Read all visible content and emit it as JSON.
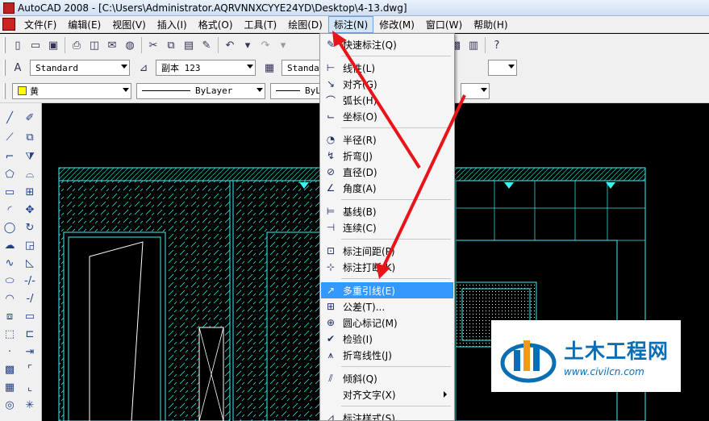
{
  "window": {
    "title": "AutoCAD 2008 - [C:\\Users\\Administrator.AQRVNNXCYYE24YD\\Desktop\\4-13.dwg]"
  },
  "menubar": [
    {
      "label": "文件(F)"
    },
    {
      "label": "编辑(E)"
    },
    {
      "label": "视图(V)"
    },
    {
      "label": "插入(I)"
    },
    {
      "label": "格式(O)"
    },
    {
      "label": "工具(T)"
    },
    {
      "label": "绘图(D)"
    },
    {
      "label": "标注(N)",
      "active": true
    },
    {
      "label": "修改(M)"
    },
    {
      "label": "窗口(W)"
    },
    {
      "label": "帮助(H)"
    }
  ],
  "styles_toolbar": {
    "text_style": "Standard",
    "dim_style": "副本 123",
    "table_style": "Standard"
  },
  "properties_toolbar": {
    "color": "黄",
    "linetype": "ByLayer",
    "lineweight": "ByL"
  },
  "dimension_menu": {
    "items": [
      {
        "label": "快速标注(Q)",
        "icon": "quick-dim-icon"
      },
      {
        "sep": true
      },
      {
        "label": "线性(L)",
        "icon": "linear-icon"
      },
      {
        "label": "对齐(G)",
        "icon": "aligned-icon"
      },
      {
        "label": "弧长(H)",
        "icon": "arc-length-icon"
      },
      {
        "label": "坐标(O)",
        "icon": "ordinate-icon"
      },
      {
        "sep": true
      },
      {
        "label": "半径(R)",
        "icon": "radius-icon"
      },
      {
        "label": "折弯(J)",
        "icon": "jogged-icon"
      },
      {
        "label": "直径(D)",
        "icon": "diameter-icon"
      },
      {
        "label": "角度(A)",
        "icon": "angular-icon"
      },
      {
        "sep": true
      },
      {
        "label": "基线(B)",
        "icon": "baseline-icon"
      },
      {
        "label": "连续(C)",
        "icon": "continue-icon"
      },
      {
        "sep": true
      },
      {
        "label": "标注间距(P)",
        "icon": "dim-space-icon"
      },
      {
        "label": "标注打断(K)",
        "icon": "dim-break-icon"
      },
      {
        "sep": true
      },
      {
        "label": "多重引线(E)",
        "icon": "multileader-icon",
        "highlighted": true
      },
      {
        "label": "公差(T)...",
        "icon": "tolerance-icon"
      },
      {
        "label": "圆心标记(M)",
        "icon": "center-mark-icon"
      },
      {
        "label": "检验(I)",
        "icon": "inspection-icon"
      },
      {
        "label": "折弯线性(J)",
        "icon": "jogged-linear-icon"
      },
      {
        "sep": true
      },
      {
        "label": "倾斜(Q)",
        "icon": "oblique-icon"
      },
      {
        "label": "对齐文字(X)",
        "icon": "",
        "submenu": true
      },
      {
        "sep": true
      },
      {
        "label": "标注样式(S)...",
        "icon": "dim-style-icon"
      }
    ]
  },
  "watermark": {
    "title": "土木工程网",
    "url": "www.civilcn.com"
  },
  "colors": {
    "cad_cyan": "#3ff0f0",
    "highlight": "#3399ff",
    "arrow_red": "#e8141a"
  }
}
